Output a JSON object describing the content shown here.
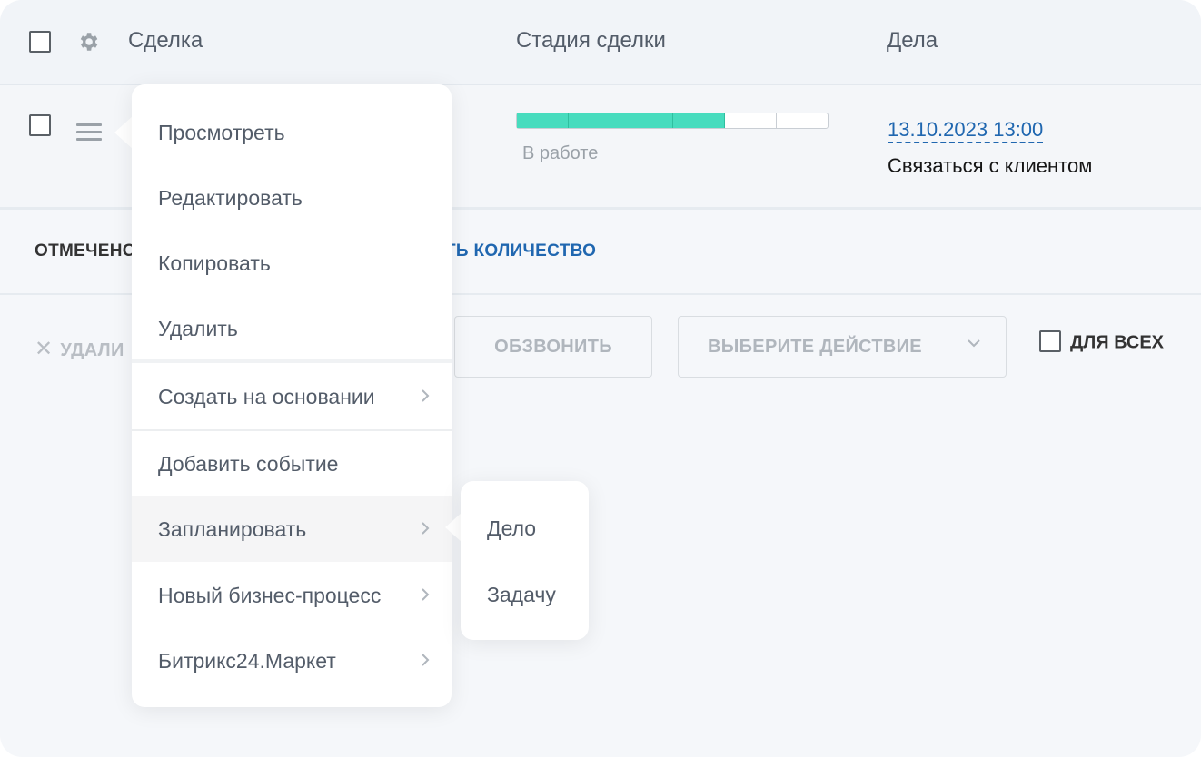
{
  "header": {
    "deal_col": "Сделка",
    "stage_col": "Стадия сделки",
    "tasks_col": "Дела"
  },
  "row": {
    "stage_label": "В работе",
    "stage_progress": {
      "filled": 4,
      "total": 6
    },
    "date": "13.10.2023 13:00",
    "task": "Связаться с клиентом"
  },
  "selection": {
    "selected_label": "ОТМЕЧЕНО",
    "show_count_link": "ТЬ КОЛИЧЕСТВО"
  },
  "actions": {
    "delete": "УДАЛИ",
    "call": "ОБЗВОНИТЬ",
    "select_action": "ВЫБЕРИТЕ ДЕЙСТВИЕ",
    "for_all": "ДЛЯ ВСЕХ"
  },
  "menu": {
    "items": [
      {
        "label": "Просмотреть"
      },
      {
        "label": "Редактировать"
      },
      {
        "label": "Копировать"
      },
      {
        "label": "Удалить"
      },
      {
        "label": "Создать на основании",
        "submenu": true
      },
      {
        "label": "Добавить событие"
      },
      {
        "label": "Запланировать",
        "submenu": true
      },
      {
        "label": "Новый бизнес-процесс",
        "submenu": true
      },
      {
        "label": "Битрикс24.Маркет",
        "submenu": true
      }
    ]
  },
  "submenu": {
    "items": [
      {
        "label": "Дело"
      },
      {
        "label": "Задачу"
      }
    ]
  },
  "colors": {
    "accent": "#2067b0",
    "progress_fill": "#47dcbe",
    "text": "#535c69"
  }
}
